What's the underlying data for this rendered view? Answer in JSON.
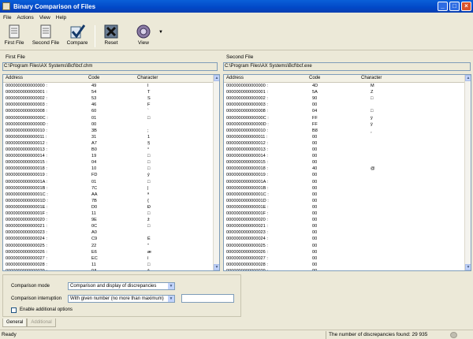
{
  "window": {
    "title": "Binary Comparison of Files"
  },
  "menu": [
    "File",
    "Actions",
    "View",
    "Help"
  ],
  "toolbar": {
    "first_file": "First File",
    "second_file": "Second File",
    "compare": "Compare",
    "reset": "Reset",
    "view": "View"
  },
  "columns": {
    "address": "Address",
    "code": "Code",
    "character": "Character"
  },
  "left_panel": {
    "title": "First File",
    "path": "C:\\Program Files\\AX Systems\\Bcf\\bcf.chm",
    "rows": [
      [
        "0000000000000000 :",
        "49",
        "I"
      ],
      [
        "0000000000000001 :",
        "54",
        "T"
      ],
      [
        "0000000000000002 :",
        "53",
        "S"
      ],
      [
        "0000000000000003 :",
        "46",
        "F"
      ],
      [
        "0000000000000008 :",
        "60",
        "`"
      ],
      [
        "000000000000000C :",
        "01",
        "□"
      ],
      [
        "000000000000000D :",
        "00",
        ""
      ],
      [
        "0000000000000010 :",
        "3B",
        ";"
      ],
      [
        "0000000000000011 :",
        "31",
        "1"
      ],
      [
        "0000000000000012 :",
        "A7",
        "§"
      ],
      [
        "0000000000000013 :",
        "B0",
        "°"
      ],
      [
        "0000000000000014 :",
        "19",
        "□"
      ],
      [
        "0000000000000015 :",
        "04",
        "□"
      ],
      [
        "0000000000000018 :",
        "10",
        "□"
      ],
      [
        "0000000000000019 :",
        "FD",
        "ý"
      ],
      [
        "000000000000001A :",
        "01",
        "□"
      ],
      [
        "000000000000001B :",
        "7C",
        "|"
      ],
      [
        "000000000000001C :",
        "AA",
        "ª"
      ],
      [
        "000000000000001D :",
        "7B",
        "{"
      ],
      [
        "000000000000001E :",
        "D0",
        "Ð"
      ],
      [
        "000000000000001F :",
        "11",
        "□"
      ],
      [
        "0000000000000020 :",
        "9E",
        "ž"
      ],
      [
        "0000000000000021 :",
        "0C",
        "□"
      ],
      [
        "0000000000000023 :",
        "A0",
        ""
      ],
      [
        "0000000000000024 :",
        "C9",
        "É"
      ],
      [
        "0000000000000025 :",
        "22",
        "\""
      ],
      [
        "0000000000000026 :",
        "E6",
        "æ"
      ],
      [
        "0000000000000027 :",
        "EC",
        "ì"
      ],
      [
        "0000000000000028 :",
        "11",
        "□"
      ],
      [
        "0000000000000029 :",
        "9A",
        "š"
      ]
    ]
  },
  "right_panel": {
    "title": "Second File",
    "path": "C:\\Program Files\\AX Systems\\Bcf\\bcf.exe",
    "rows": [
      [
        "0000000000000000 :",
        "4D",
        "M"
      ],
      [
        "0000000000000001 :",
        "5A",
        "Z"
      ],
      [
        "0000000000000002 :",
        "90",
        "□"
      ],
      [
        "0000000000000003 :",
        "00",
        ""
      ],
      [
        "0000000000000008 :",
        "04",
        "□"
      ],
      [
        "000000000000000C :",
        "FF",
        "ÿ"
      ],
      [
        "000000000000000D :",
        "FF",
        "ÿ"
      ],
      [
        "0000000000000010 :",
        "B8",
        "¸"
      ],
      [
        "0000000000000011 :",
        "00",
        ""
      ],
      [
        "0000000000000012 :",
        "00",
        ""
      ],
      [
        "0000000000000013 :",
        "00",
        ""
      ],
      [
        "0000000000000014 :",
        "00",
        ""
      ],
      [
        "0000000000000015 :",
        "00",
        ""
      ],
      [
        "0000000000000018 :",
        "40",
        "@"
      ],
      [
        "0000000000000019 :",
        "00",
        ""
      ],
      [
        "000000000000001A :",
        "00",
        ""
      ],
      [
        "000000000000001B :",
        "00",
        ""
      ],
      [
        "000000000000001C :",
        "00",
        ""
      ],
      [
        "000000000000001D :",
        "00",
        ""
      ],
      [
        "000000000000001E :",
        "00",
        ""
      ],
      [
        "000000000000001F :",
        "00",
        ""
      ],
      [
        "0000000000000020 :",
        "00",
        ""
      ],
      [
        "0000000000000021 :",
        "00",
        ""
      ],
      [
        "0000000000000023 :",
        "00",
        ""
      ],
      [
        "0000000000000024 :",
        "00",
        ""
      ],
      [
        "0000000000000025 :",
        "00",
        ""
      ],
      [
        "0000000000000026 :",
        "00",
        ""
      ],
      [
        "0000000000000027 :",
        "00",
        ""
      ],
      [
        "0000000000000028 :",
        "00",
        ""
      ],
      [
        "0000000000000029 :",
        "00",
        ""
      ]
    ]
  },
  "options": {
    "mode_label": "Comparison mode",
    "mode_value": "Comparison and display of discrepancies",
    "interrupt_label": "Comparison interruption",
    "interrupt_value": "With given number (no more than maximum)",
    "interrupt_number": "",
    "additional_label": "Enable additional options"
  },
  "tabs": [
    "General",
    "Additional"
  ],
  "status": {
    "left": "Ready",
    "right": "The number of discrepancies found: 29 935"
  },
  "colors": {
    "titlebar": "#0148c7",
    "window_bg": "#ece9d8",
    "grid_bg": "#ffffff"
  }
}
